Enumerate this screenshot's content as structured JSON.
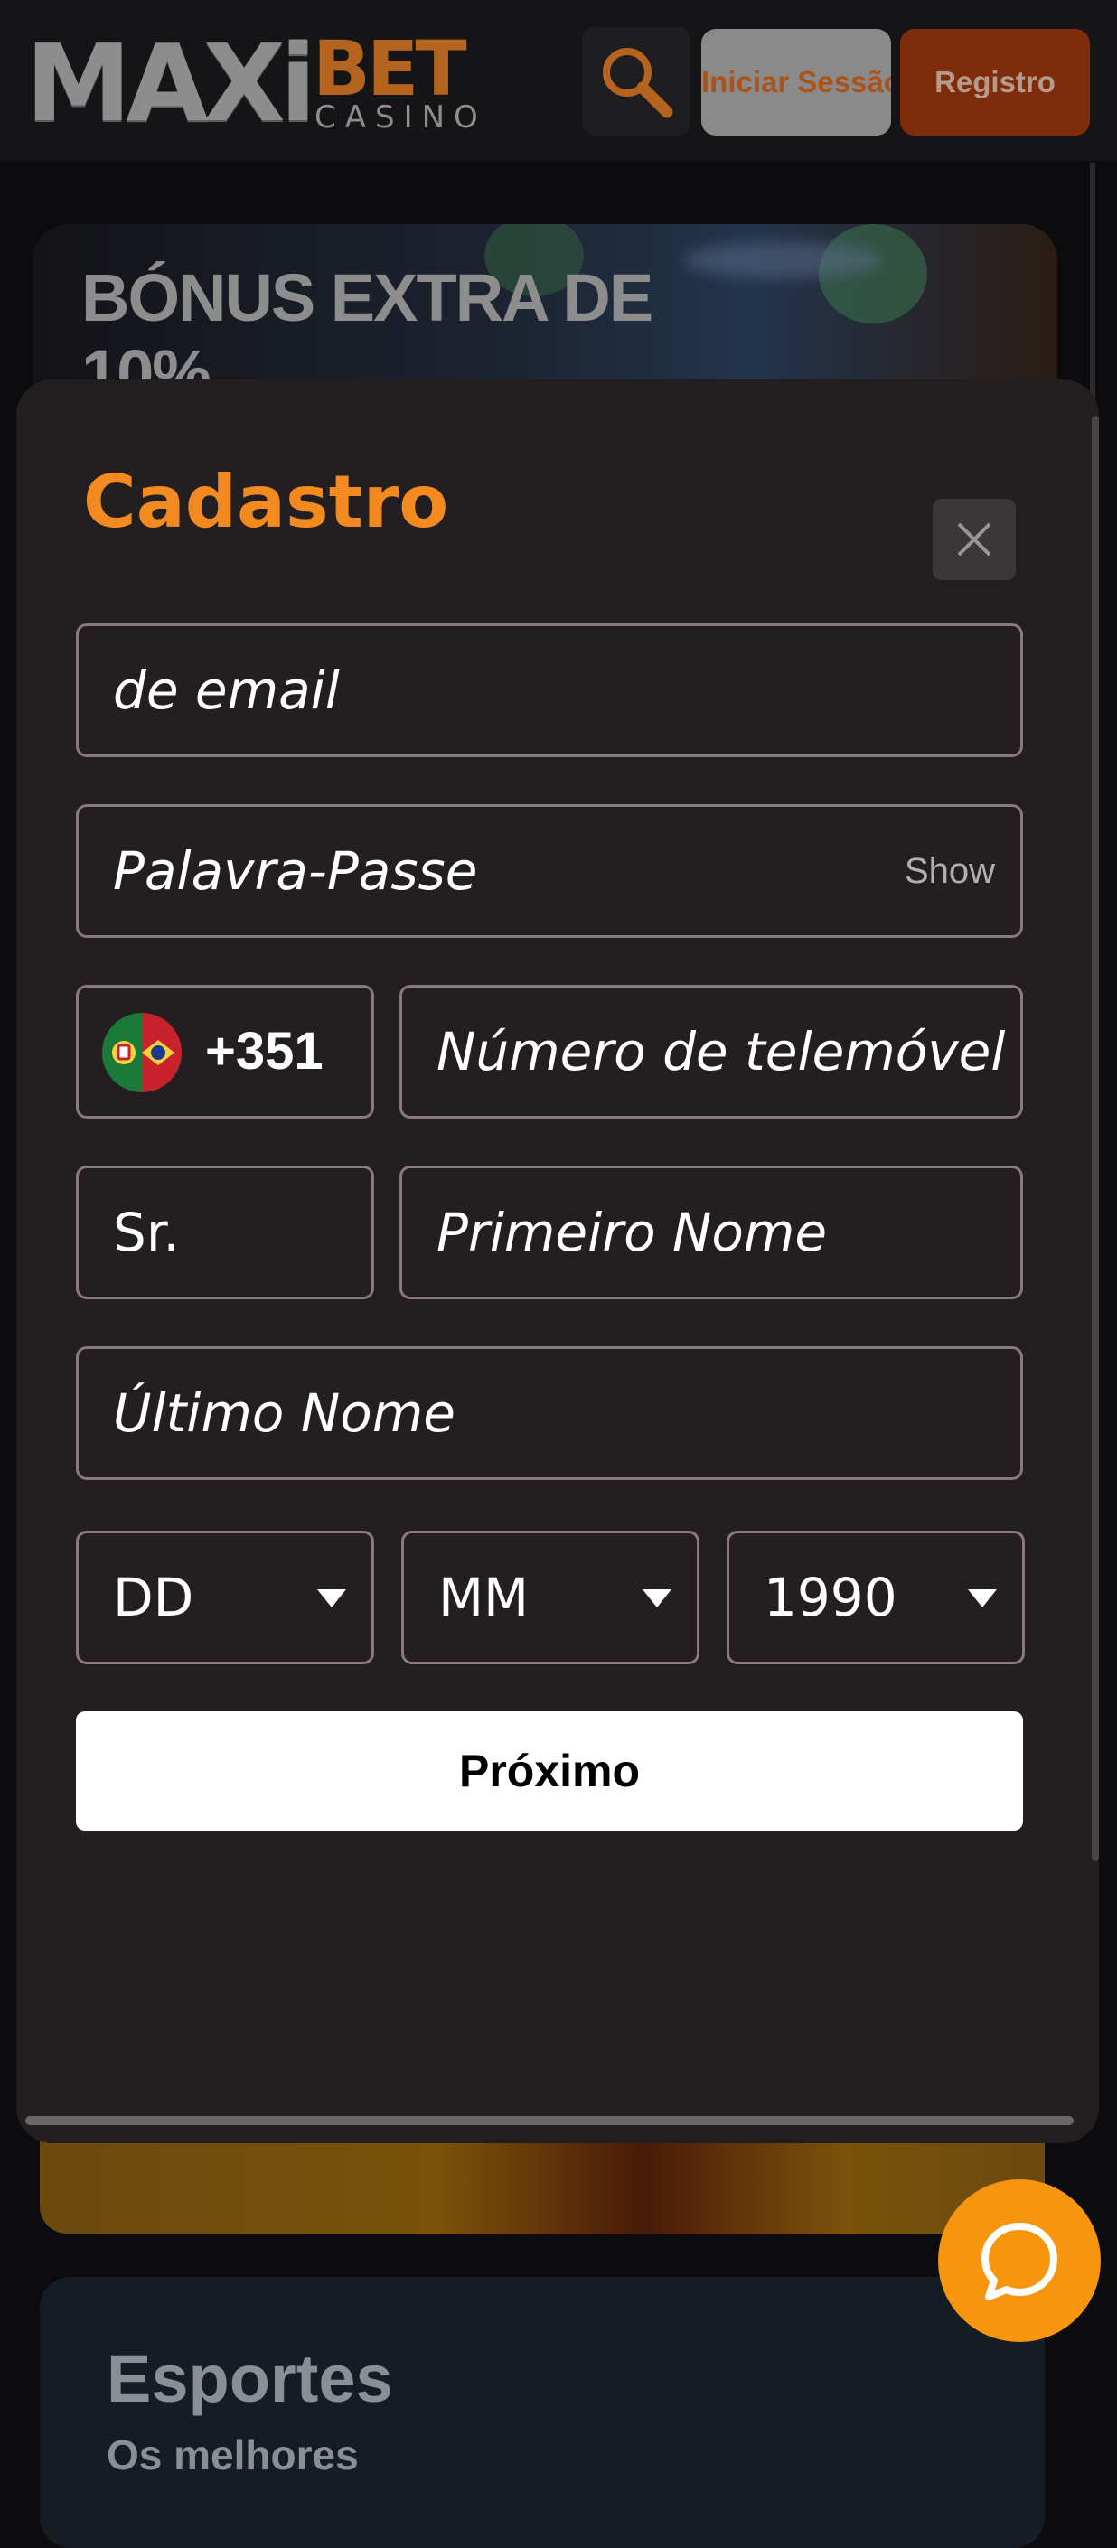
{
  "header": {
    "logo": {
      "maxi": "MAXi",
      "bet": "BET",
      "casino": "CASINO"
    },
    "search_icon": "search-icon",
    "login_label": "Iniciar Sessão",
    "register_label": "Registro"
  },
  "background": {
    "promo_title": "BÓNUS EXTRA DE 10%",
    "sports_title": "Esportes",
    "sports_subtitle": "Os melhores"
  },
  "modal": {
    "title": "Cadastro",
    "close_icon": "close-icon",
    "email_placeholder": "de email",
    "password_placeholder": "Palavra-Passe",
    "show_label": "Show",
    "phone_code": "+351",
    "phone_placeholder": "Número de telemóvel",
    "salutation": "Sr.",
    "first_name_placeholder": "Primeiro Nome",
    "last_name_placeholder": "Último Nome",
    "day": "DD",
    "month": "MM",
    "year": "1990",
    "next_label": "Próximo"
  },
  "chat_icon": "chat-icon",
  "colors": {
    "accent_orange": "#f28a20",
    "chat_orange": "#f7950f",
    "modal_bg": "#231f20",
    "field_border": "#8c7880"
  }
}
